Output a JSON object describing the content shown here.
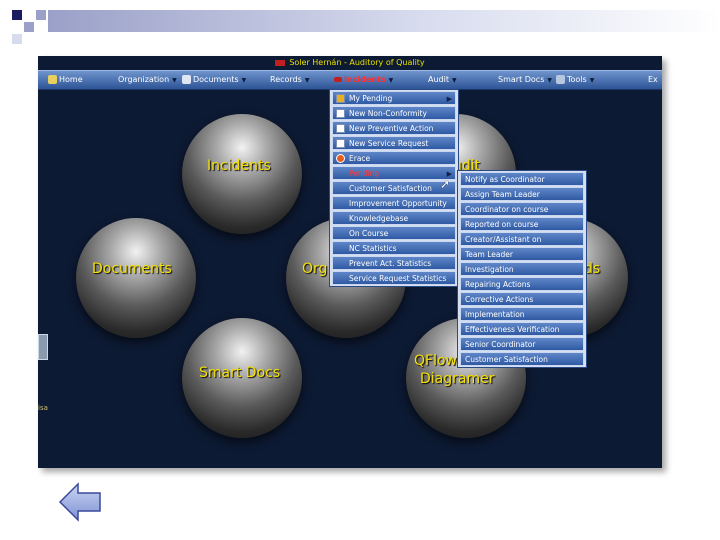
{
  "app": {
    "title": "Soler Hernán - Auditory of Quality"
  },
  "navbar": {
    "items": [
      {
        "label": "Home"
      },
      {
        "label": "Organization"
      },
      {
        "label": "Documents"
      },
      {
        "label": "Records"
      },
      {
        "label": "Incidents",
        "active": true
      },
      {
        "label": "Audit"
      },
      {
        "label": "Smart Docs"
      },
      {
        "label": "Tools"
      },
      {
        "label": "Ex"
      }
    ]
  },
  "spheres": [
    {
      "label": "Incidents"
    },
    {
      "label": "udit"
    },
    {
      "label": "Documents"
    },
    {
      "label": "Org"
    },
    {
      "label": "ds"
    },
    {
      "label": "Smart Docs"
    },
    {
      "label": "QFlow",
      "label2": "Diagramer"
    }
  ],
  "incidents_menu": {
    "items": [
      {
        "label": "My Pending",
        "icon": "star-icon",
        "submenu": true
      },
      {
        "label": "New Non-Conformity",
        "icon": "document-icon"
      },
      {
        "label": "New Preventive Action",
        "icon": "document-icon"
      },
      {
        "label": "New Service Request",
        "icon": "document-icon"
      },
      {
        "label": "Erace",
        "icon": "alert-icon"
      },
      {
        "label": "Pending",
        "submenu": true,
        "highlight": true
      },
      {
        "label": "Customer Satisfaction"
      },
      {
        "label": "Improvement Opportunity"
      },
      {
        "label": "Knowledgebase"
      },
      {
        "label": "On Course"
      },
      {
        "label": "NC Statistics"
      },
      {
        "label": "Prevent Act. Statistics"
      },
      {
        "label": "Service Request Statistics"
      }
    ]
  },
  "pending_submenu": {
    "items": [
      {
        "label": "Notify as Coordinator"
      },
      {
        "label": "Assign Team Leader"
      },
      {
        "label": "Coordinator on course"
      },
      {
        "label": "Reported on course"
      },
      {
        "label": "Creator/Assistant on"
      },
      {
        "label": "Team Leader"
      },
      {
        "label": "Investigation"
      },
      {
        "label": "Repairing Actions"
      },
      {
        "label": "Corrective Actions"
      },
      {
        "label": "Implementation"
      },
      {
        "label": "Effectiveness Verification"
      },
      {
        "label": "Senior Coordinator"
      },
      {
        "label": "Customer Satisfaction"
      }
    ]
  },
  "stub": {
    "text": "isa"
  },
  "colors": {
    "background": "#0d1a33",
    "menu_blue": "#2f5aa3",
    "label_yellow": "#f5e000",
    "active_red": "#ff3030"
  }
}
